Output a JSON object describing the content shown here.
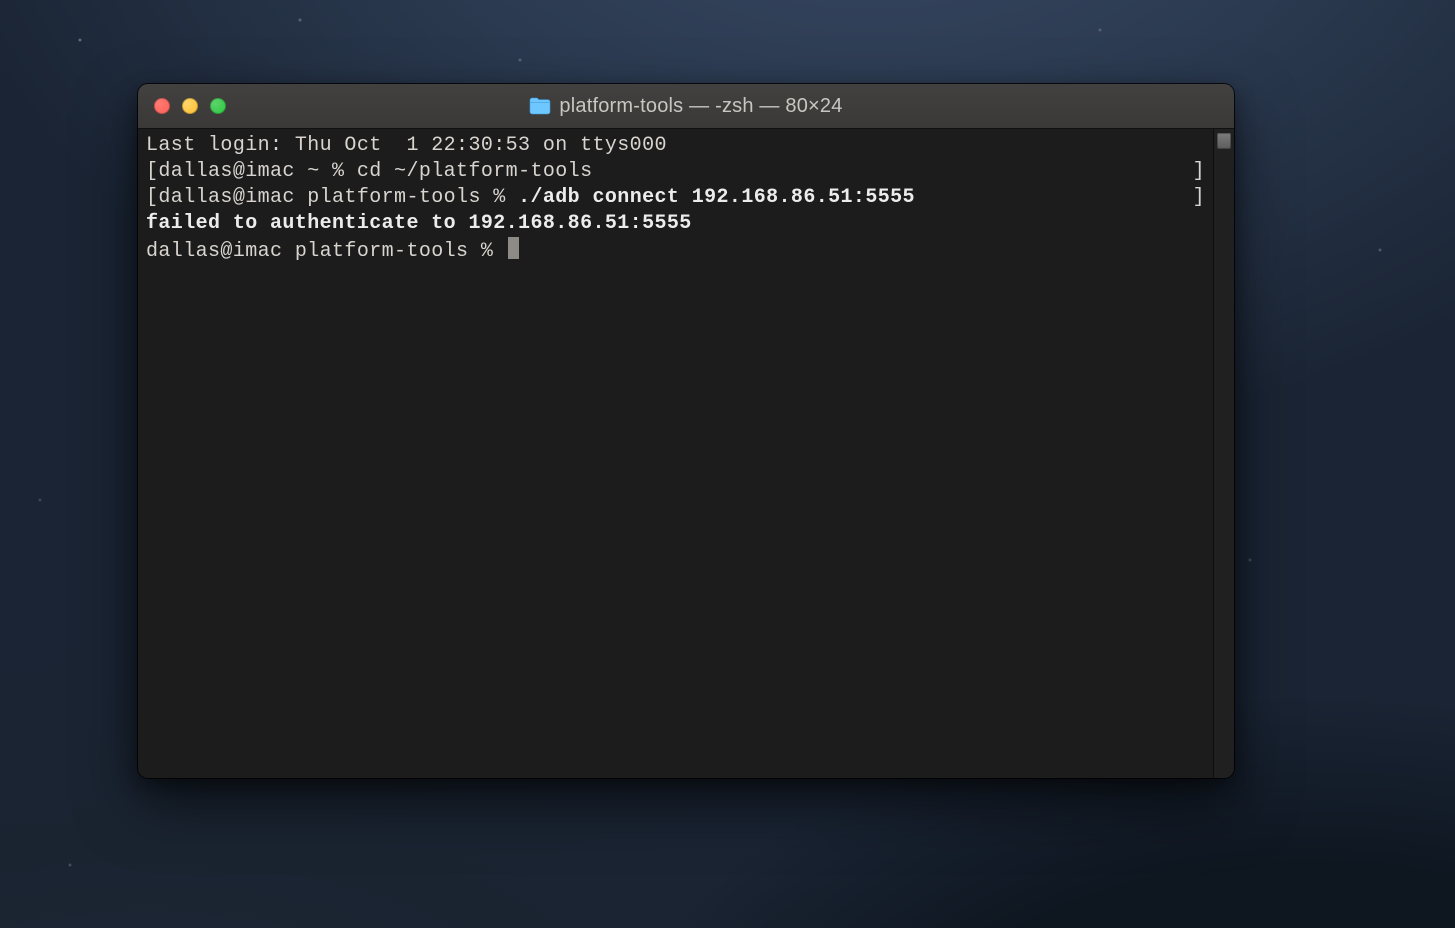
{
  "window": {
    "title": "platform-tools — -zsh — 80×24",
    "folder_icon": "folder-icon"
  },
  "traffic_lights": {
    "close": "close",
    "minimize": "minimize",
    "zoom": "zoom"
  },
  "terminal": {
    "lines": [
      {
        "bracketed": false,
        "prompt": "",
        "command": "",
        "bold": false,
        "text": "Last login: Thu Oct  1 22:30:53 on ttys000"
      },
      {
        "bracketed": true,
        "prompt": "dallas@imac ~ % ",
        "command": "cd ~/platform-tools",
        "bold": false
      },
      {
        "bracketed": true,
        "prompt": "dallas@imac platform-tools % ",
        "command": "./adb connect 192.168.86.51:5555",
        "bold": true
      },
      {
        "bracketed": false,
        "text": "failed to authenticate to 192.168.86.51:5555",
        "bold": true
      },
      {
        "bracketed": false,
        "prompt": "dallas@imac platform-tools % ",
        "cursor": true
      }
    ]
  }
}
